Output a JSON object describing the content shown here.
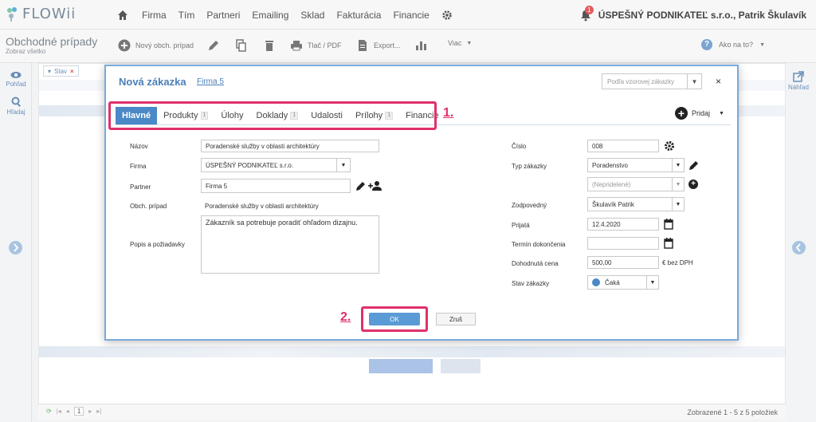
{
  "app": {
    "name": "FLOWii"
  },
  "nav": {
    "items": [
      "Firma",
      "Tím",
      "Partneri",
      "Emailing",
      "Sklad",
      "Fakturácia",
      "Financie"
    ],
    "notification_count": "1",
    "user": "ÚSPEŠNÝ PODNIKATEĽ s.r.o., Patrik Škulavík"
  },
  "toolbar": {
    "title": "Obchodné prípady",
    "subtitle": "Zobraz všetko",
    "new_label": "Nový obch. prípad",
    "print_label": "Tlač / PDF",
    "export_label": "Export...",
    "more_label": "Viac",
    "help_label": "Ako na to?"
  },
  "left_panel": {
    "view_label": "Pohľad",
    "search_label": "Hľadaj"
  },
  "right_panel": {
    "preview_label": "Náhľad"
  },
  "list": {
    "filter_tag": "Stav",
    "pager_page": "1",
    "count_text": "Zobrazené 1 - 5 z 5 položiek"
  },
  "modal": {
    "title": "Nová zákazka",
    "link": "Firma 5",
    "template_placeholder": "Podľa vzorovej zákazky",
    "close": "×",
    "tabs": [
      {
        "label": "Hlavné",
        "count": ""
      },
      {
        "label": "Produkty",
        "count": "1"
      },
      {
        "label": "Úlohy",
        "count": ""
      },
      {
        "label": "Doklady",
        "count": "1"
      },
      {
        "label": "Udalosti",
        "count": ""
      },
      {
        "label": "Prílohy",
        "count": "1"
      },
      {
        "label": "Financie",
        "count": ""
      }
    ],
    "add_label": "Pridaj",
    "left": {
      "name_label": "Názov",
      "name_value": "Poradenské služby v oblasti architektúry",
      "company_label": "Firma",
      "company_value": "ÚSPEŠNÝ PODNIKATEĽ s.r.o.",
      "partner_label": "Partner",
      "partner_value": "Firma 5",
      "deal_label": "Obch. prípad",
      "deal_value": "Poradenské služby v oblasti architektúry",
      "desc_label": "Popis a požiadavky",
      "desc_value": "Zákazník sa potrebuje poradiť ohľadom dizajnu."
    },
    "right": {
      "number_label": "Číslo",
      "number_value": "008",
      "type_label": "Typ zákazky",
      "type_value": "Poradenstvo",
      "type2_value": "(Nepridelené)",
      "owner_label": "Zodpovedný",
      "owner_value": "Škulavík Patrik",
      "received_label": "Prijatá",
      "received_value": "12.4.2020",
      "deadline_label": "Termín dokončenia",
      "deadline_value": "",
      "price_label": "Dohodnutá cena",
      "price_value": "500,00",
      "price_unit": "€ bez DPH",
      "status_label": "Stav zákazky",
      "status_value": "Čaká"
    },
    "ok_label": "OK",
    "cancel_label": "Zruš",
    "callout_1": "1.",
    "callout_2": "2."
  },
  "colors": {
    "accent": "#4a88c7",
    "callout": "#e0306a",
    "modal_border": "#7aaad8"
  }
}
